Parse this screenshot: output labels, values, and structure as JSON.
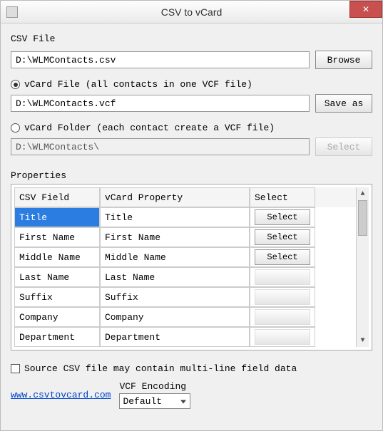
{
  "window": {
    "title": "CSV to vCard"
  },
  "csv_section": {
    "label": "CSV File",
    "path": "D:\\WLMContacts.csv",
    "browse_label": "Browse"
  },
  "vcard_file_section": {
    "radio_label": "vCard File (all contacts in one VCF file)",
    "path": "D:\\WLMContacts.vcf",
    "saveas_label": "Save as"
  },
  "vcard_folder_section": {
    "radio_label": "vCard Folder (each contact create a VCF file)",
    "path": "D:\\WLMContacts\\",
    "select_label": "Select"
  },
  "properties": {
    "label": "Properties",
    "headers": {
      "csv": "CSV Field",
      "vcard": "vCard Property",
      "select": "Select"
    },
    "rows": [
      {
        "csv": "Title",
        "vcard": "Title",
        "select": "Select",
        "selected": true,
        "active": true
      },
      {
        "csv": "First Name",
        "vcard": "First Name",
        "select": "Select",
        "selected": false,
        "active": true
      },
      {
        "csv": "Middle Name",
        "vcard": "Middle Name",
        "select": "Select",
        "selected": false,
        "active": true
      },
      {
        "csv": "Last Name",
        "vcard": "Last Name",
        "select": "",
        "selected": false,
        "active": false
      },
      {
        "csv": "Suffix",
        "vcard": "Suffix",
        "select": "",
        "selected": false,
        "active": false
      },
      {
        "csv": "Company",
        "vcard": "Company",
        "select": "",
        "selected": false,
        "active": false
      },
      {
        "csv": "Department",
        "vcard": "Department",
        "select": "",
        "selected": false,
        "active": false
      }
    ]
  },
  "footer": {
    "checkbox_label": "Source CSV file may contain multi-line field data",
    "link_text": "www.csvtovcard.com",
    "encoding_label": "VCF Encoding",
    "encoding_value": "Default"
  }
}
